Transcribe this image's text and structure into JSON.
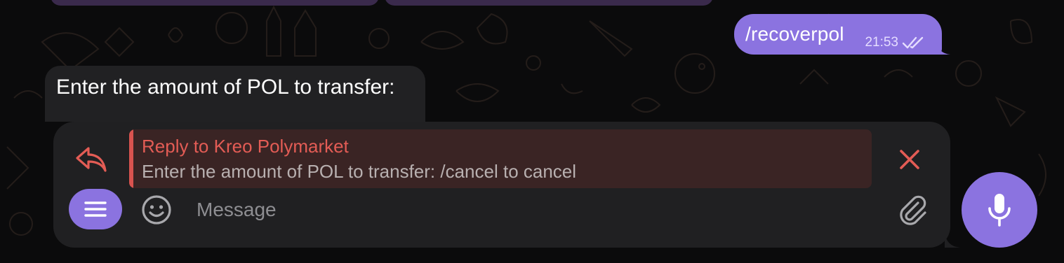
{
  "colors": {
    "accent": "#8b73e0",
    "reply_accent": "#e35c55",
    "bubble_incoming": "#212123",
    "composer_bg": "#202022"
  },
  "outgoing_message": {
    "text": "/recoverpol",
    "time": "21:53",
    "status_icon": "double-check-icon"
  },
  "incoming_message": {
    "text": "Enter the amount of POL to transfer:"
  },
  "reply_preview": {
    "icon": "reply-arrow-icon",
    "title": "Reply to Kreo Polymarket",
    "text": "Enter the amount of POL to transfer: /cancel to cancel",
    "close_icon": "close-icon"
  },
  "composer": {
    "menu_icon": "menu-icon",
    "emoji_icon": "emoji-icon",
    "placeholder": "Message",
    "value": "",
    "attach_icon": "paperclip-icon",
    "send_icon": "microphone-icon"
  }
}
